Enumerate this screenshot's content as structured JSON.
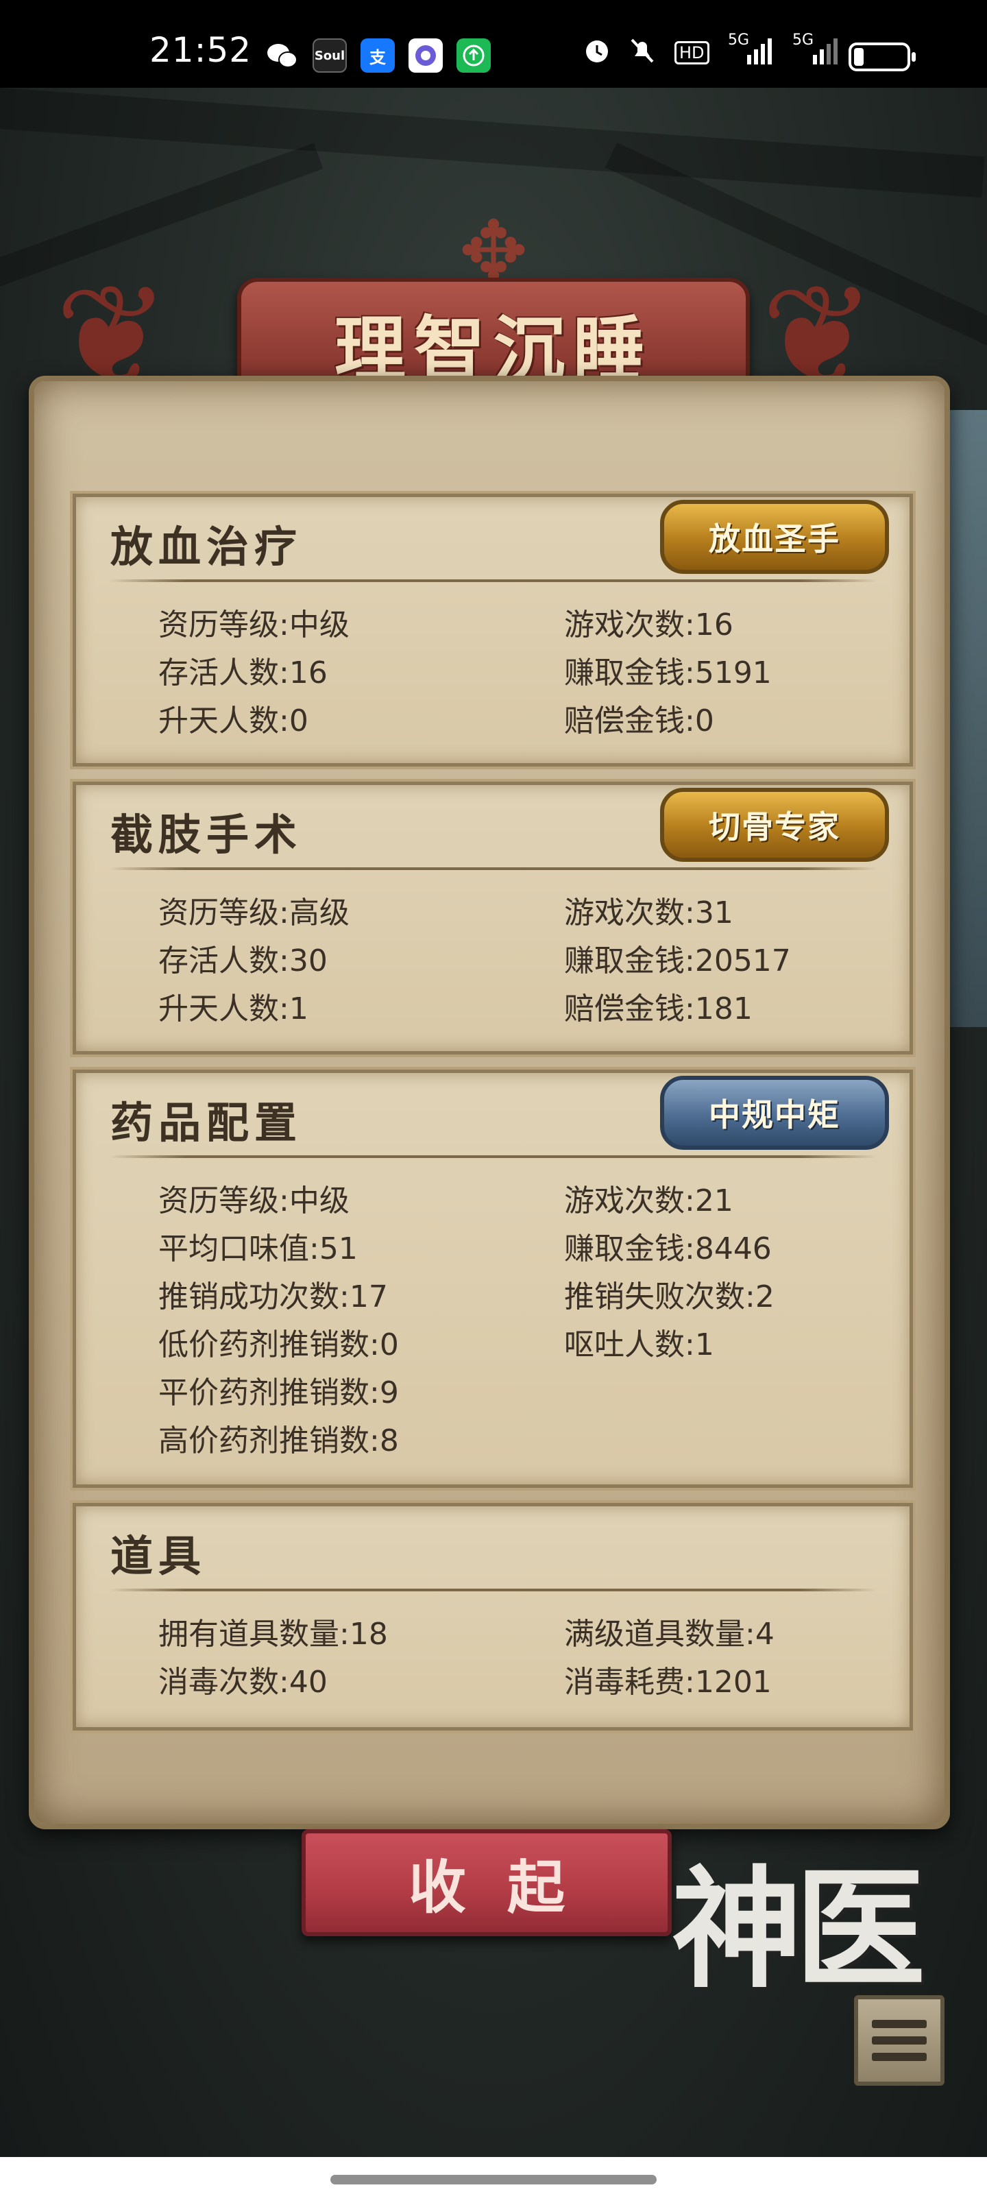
{
  "status_bar": {
    "time": "21:52",
    "apps": [
      {
        "icon": "wechat-icon",
        "label": "",
        "color": "#000000"
      },
      {
        "icon": "soul-icon",
        "label": "Soul",
        "color": "#222222"
      },
      {
        "icon": "alipay-icon",
        "label": "支",
        "color": "#1677ff"
      },
      {
        "icon": "browser-icon",
        "label": "",
        "color": "#6b5bd6"
      },
      {
        "icon": "update-icon",
        "label": "",
        "color": "#1db954"
      }
    ],
    "indicators": [
      "alarm-icon",
      "mute-icon",
      "HD",
      "5G",
      "5G"
    ],
    "battery_level": 0.15
  },
  "title": "理智沉睡",
  "sections": [
    {
      "title": "放血治疗",
      "badge": "放血圣手",
      "badge_style": "gold",
      "left": [
        {
          "label": "资历等级",
          "value": "中级"
        },
        {
          "label": "存活人数",
          "value": "16"
        },
        {
          "label": "升天人数",
          "value": "0"
        }
      ],
      "right": [
        {
          "label": "游戏次数",
          "value": "16"
        },
        {
          "label": "赚取金钱",
          "value": "5191"
        },
        {
          "label": "赔偿金钱",
          "value": "0"
        }
      ]
    },
    {
      "title": "截肢手术",
      "badge": "切骨专家",
      "badge_style": "gold",
      "left": [
        {
          "label": "资历等级",
          "value": "高级"
        },
        {
          "label": "存活人数",
          "value": "30"
        },
        {
          "label": "升天人数",
          "value": "1"
        }
      ],
      "right": [
        {
          "label": "游戏次数",
          "value": "31"
        },
        {
          "label": "赚取金钱",
          "value": "20517"
        },
        {
          "label": "赔偿金钱",
          "value": "181"
        }
      ]
    },
    {
      "title": "药品配置",
      "badge": "中规中矩",
      "badge_style": "blue",
      "left": [
        {
          "label": "资历等级",
          "value": "中级"
        },
        {
          "label": "平均口味值",
          "value": "51"
        },
        {
          "label": "推销成功次数",
          "value": "17"
        },
        {
          "label": "低价药剂推销数",
          "value": "0"
        },
        {
          "label": "平价药剂推销数",
          "value": "9"
        },
        {
          "label": "高价药剂推销数",
          "value": "8"
        }
      ],
      "right": [
        {
          "label": "游戏次数",
          "value": "21"
        },
        {
          "label": "赚取金钱",
          "value": "8446"
        },
        {
          "label": "推销失败次数",
          "value": "2"
        },
        {
          "label": "呕吐人数",
          "value": "1"
        }
      ]
    },
    {
      "title": "道具",
      "left": [
        {
          "label": "拥有道具数量",
          "value": "18"
        },
        {
          "label": "消毒次数",
          "value": "40"
        }
      ],
      "right": [
        {
          "label": "满级道具数量",
          "value": "4"
        },
        {
          "label": "消毒耗费",
          "value": "1201"
        }
      ]
    }
  ],
  "collapse_button": "收起",
  "logo_text": "神医",
  "menu_icon": "list-menu-icon"
}
